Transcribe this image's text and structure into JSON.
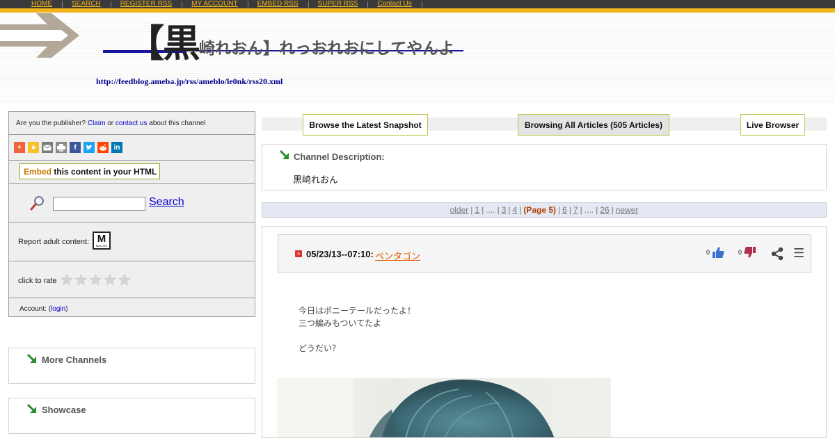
{
  "nav": {
    "items": [
      "HOME",
      "SEARCH",
      "REGISTER RSS",
      "MY ACCOUNT",
      "EMBED RSS",
      "SUPER RSS",
      "Contact Us"
    ]
  },
  "header": {
    "title_big": "【黒",
    "title_rest": "崎れおん】れっおれおにしてやんよ",
    "feed_url": "http://feedblog.ameba.jp/rss/ameblo/le0nk/rss20.xml"
  },
  "sidebar": {
    "publisher_prefix": "Are you the publisher?",
    "claim": "Claim",
    "or": "or",
    "contact_us": "contact us",
    "publisher_suffix": "about this channel",
    "share_icons": [
      "add",
      "bookmark",
      "email",
      "print",
      "facebook",
      "twitter",
      "reddit",
      "linkedin"
    ],
    "embed_highlight": "Embed",
    "embed_rest": "this content in your HTML",
    "search_link": "Search",
    "report_adult": "Report adult content:",
    "mature_badge": "M",
    "mature_sub": "MATURE",
    "rate_label": "click to rate",
    "rating_stars": 5,
    "account_prefix": "Account: (",
    "login": "login",
    "account_suffix": ")"
  },
  "boxes": {
    "more_channels": "More Channels",
    "showcase": "Showcase"
  },
  "tabs": {
    "latest": "Browse the Latest Snapshot",
    "all": "Browsing All Articles (505 Articles)",
    "live": "Live Browser"
  },
  "description": {
    "title": "Channel Description:",
    "body": "黒崎れおん"
  },
  "pager": {
    "older": "older",
    "p1": "1",
    "dots": "....",
    "p3": "3",
    "p4": "4",
    "current": "(Page 5)",
    "p6": "6",
    "p7": "7",
    "p26": "26",
    "newer": "newer"
  },
  "article": {
    "date": "05/23/13--07:10:",
    "title": "ペンタゴン",
    "up_votes": "0",
    "down_votes": "0",
    "body_lines": [
      "今日はポニーテールだったよ！",
      "三つ編みもついてたよ",
      "",
      "どうだい？"
    ]
  },
  "colors": {
    "nav_bg": "#3a3a3a",
    "accent_yellow": "#f2b41a",
    "link_blue": "#0000cc",
    "post_link_orange": "#e05a00",
    "thumb_up": "#3b6fd0",
    "thumb_down": "#b0304a"
  }
}
